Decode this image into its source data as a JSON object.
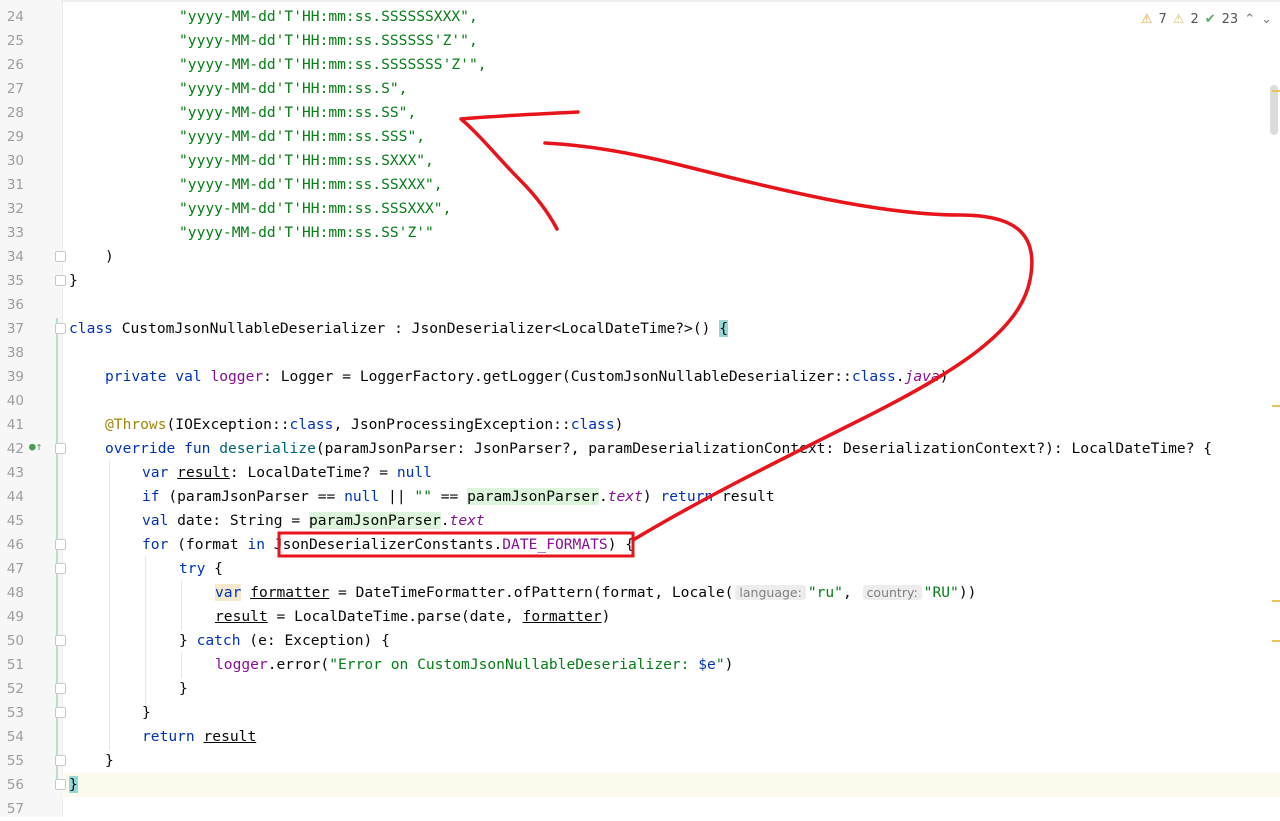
{
  "inspection_widget": {
    "warnings": "7",
    "weak_warnings": "2",
    "typos": "23",
    "warning_icon": "warning-icon",
    "weak_warning_icon": "weak-warning-icon",
    "check_icon": "check-icon",
    "up_icon": "arrow-up-icon",
    "down_icon": "arrow-down-icon"
  },
  "lines": [
    {
      "num": "24"
    },
    {
      "num": "25"
    },
    {
      "num": "26"
    },
    {
      "num": "27"
    },
    {
      "num": "28"
    },
    {
      "num": "29"
    },
    {
      "num": "30"
    },
    {
      "num": "31"
    },
    {
      "num": "32"
    },
    {
      "num": "33"
    },
    {
      "num": "34"
    },
    {
      "num": "35"
    },
    {
      "num": "36"
    },
    {
      "num": "37"
    },
    {
      "num": "38"
    },
    {
      "num": "39"
    },
    {
      "num": "40"
    },
    {
      "num": "41"
    },
    {
      "num": "42"
    },
    {
      "num": "43"
    },
    {
      "num": "44"
    },
    {
      "num": "45"
    },
    {
      "num": "46"
    },
    {
      "num": "47"
    },
    {
      "num": "48"
    },
    {
      "num": "49"
    },
    {
      "num": "50"
    },
    {
      "num": "51"
    },
    {
      "num": "52"
    },
    {
      "num": "53"
    },
    {
      "num": "54"
    },
    {
      "num": "55"
    },
    {
      "num": "56"
    },
    {
      "num": "57"
    }
  ],
  "code": {
    "l24": "\"yyyy-MM-dd'T'HH:mm:ss.SSSSSSXXX\",",
    "l25": "\"yyyy-MM-dd'T'HH:mm:ss.SSSSSS'Z'\",",
    "l26": "\"yyyy-MM-dd'T'HH:mm:ss.SSSSSSS'Z'\",",
    "l27": "\"yyyy-MM-dd'T'HH:mm:ss.S\",",
    "l28": "\"yyyy-MM-dd'T'HH:mm:ss.SS\",",
    "l29": "\"yyyy-MM-dd'T'HH:mm:ss.SSS\",",
    "l30": "\"yyyy-MM-dd'T'HH:mm:ss.SXXX\",",
    "l31": "\"yyyy-MM-dd'T'HH:mm:ss.SSXXX\",",
    "l32": "\"yyyy-MM-dd'T'HH:mm:ss.SSSXXX\",",
    "l33": "\"yyyy-MM-dd'T'HH:mm:ss.SS'Z'\"",
    "l34": ")",
    "l35": "}",
    "l37_kw": "class",
    "l37_rest": " CustomJsonNullableDeserializer : JsonDeserializer<LocalDateTime?>() ",
    "l37_brace": "{",
    "l39_kw": "private val",
    "l39_name": "logger",
    "l39_mid": ": Logger = LoggerFactory.getLogger(CustomJsonNullableDeserializer::",
    "l39_class": "class",
    "l39_dot": ".",
    "l39_java": "java",
    "l39_end": ")",
    "l41_ann": "@Throws",
    "l41_a": "(IOException::",
    "l41_class1": "class",
    "l41_b": ", JsonProcessingException::",
    "l41_class2": "class",
    "l41_c": ")",
    "l42_kw": "override fun",
    "l42_name": "deserialize",
    "l42_rest": "(paramJsonParser: JsonParser?, paramDeserializationContext: DeserializationContext?): LocalDateTime? {",
    "l43_kw": "var",
    "l43_var": "result",
    "l43_mid": ": LocalDateTime? = ",
    "l43_null": "null",
    "l44_kw": "if",
    "l44_a": " (paramJsonParser == ",
    "l44_null": "null",
    "l44_b": " || ",
    "l44_str": "\"\"",
    "l44_c": " == ",
    "l44_param": "paramJsonParser",
    "l44_dot": ".",
    "l44_text": "text",
    "l44_d": ") ",
    "l44_ret": "return",
    "l44_res": " result",
    "l45_kw": "val",
    "l45_a": " date: String = ",
    "l45_param": "paramJsonParser",
    "l45_dot": ".",
    "l45_text": "text",
    "l46_kw": "for",
    "l46_a": " (format ",
    "l46_in": "in",
    "l46_obj": "JsonDeserializerConstants.",
    "l46_const": "DATE_FORMATS",
    "l46_b": ") {",
    "l47_kw": "try",
    "l47_b": " {",
    "l48_kw": "var",
    "l48_var": "formatter",
    "l48_a": " = DateTimeFormatter.ofPattern(format, Locale(",
    "l48_hint1": "language:",
    "l48_str1": "\"ru\"",
    "l48_comma": ", ",
    "l48_hint2": "country:",
    "l48_str2": "\"RU\"",
    "l48_end": "))",
    "l49_var": "result",
    "l49_a": " = LocalDateTime.parse(date, ",
    "l49_var2": "formatter",
    "l49_end": ")",
    "l50_a": "} ",
    "l50_kw": "catch",
    "l50_b": " (e: Exception) {",
    "l51_logger": "logger",
    "l51_a": ".error(",
    "l51_str": "\"Error on CustomJsonNullableDeserializer: ",
    "l51_tpl": "$e",
    "l51_str_end": "\"",
    "l51_end": ")",
    "l52": "}",
    "l53": "}",
    "l54_kw": "return",
    "l54_var": "result",
    "l55": "}",
    "l56": "}"
  },
  "colors": {
    "annotation_red": "#e8141b",
    "keyword": "#0033b3",
    "string": "#067d17"
  }
}
